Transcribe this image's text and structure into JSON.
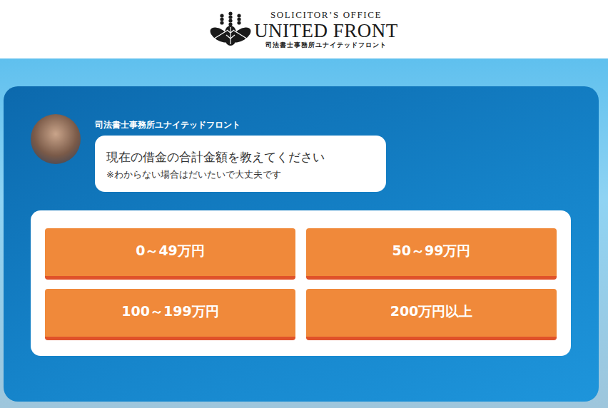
{
  "header": {
    "logo": {
      "overline": "SOLICITOR’S OFFICE",
      "title": "UNITED FRONT",
      "subtitle": "司法書士事務所ユナイテッドフロント"
    }
  },
  "chat": {
    "sender": "司法書士事務所ユナイテッドフロント",
    "question": "現在の借金の合計金額を教えてください",
    "note": "※わからない場合はだいたいで大丈夫です"
  },
  "options": [
    {
      "label": "0～49万円",
      "selected": false
    },
    {
      "label": "50～99万円",
      "selected": false
    },
    {
      "label": "100～199万円",
      "selected": false
    },
    {
      "label": "200万円以上",
      "selected": false
    }
  ]
}
